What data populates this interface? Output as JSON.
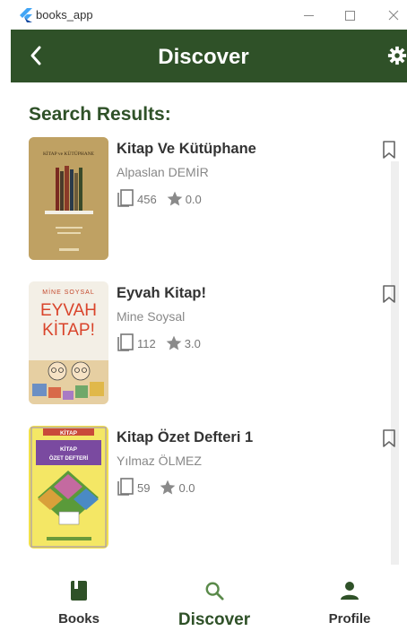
{
  "window": {
    "title": "books_app",
    "controls": {
      "minimize": "—",
      "maximize": "☐",
      "close": "✕"
    }
  },
  "appbar": {
    "title": "Discover",
    "back_icon": "chevron-left-icon",
    "settings_icon": "gear-icon"
  },
  "colors": {
    "primary": "#2f5128",
    "accent_icon": "#5a8a4a",
    "text_muted": "#888888",
    "cover_1_bg": "#b99b5c",
    "cover_2_bg": "#f3efe6",
    "cover_3_bg": "#f1e04c"
  },
  "section": {
    "title": "Search Results:"
  },
  "books": [
    {
      "title": "Kitap Ve Kütüphane",
      "author": "Alpaslan DEMİR",
      "pages": "456",
      "rating": "0.0",
      "cover_lines": [
        "KİTAP ve KÜTÜPHANE"
      ]
    },
    {
      "title": "Eyvah Kitap!",
      "author": "Mine Soysal",
      "pages": "112",
      "rating": "3.0",
      "cover_lines": [
        "MİNE SOYSAL",
        "EYVAH",
        "KİTAP!"
      ]
    },
    {
      "title": "Kitap Özet Defteri 1",
      "author": "Yılmaz ÖLMEZ",
      "pages": "59",
      "rating": "0.0",
      "cover_lines": [
        "KİTAP",
        "KİTAP",
        "ÖZET DEFTERİ"
      ]
    }
  ],
  "bottom_nav": [
    {
      "label": "Books",
      "icon": "book-icon",
      "active": false
    },
    {
      "label": "Discover",
      "icon": "search-icon",
      "active": true
    },
    {
      "label": "Profile",
      "icon": "person-icon",
      "active": false
    }
  ]
}
